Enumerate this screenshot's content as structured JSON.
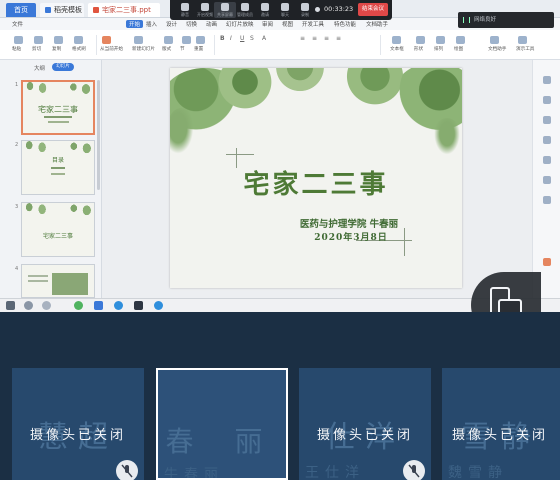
{
  "tabs": {
    "home": "首页",
    "t1": "稻壳模板",
    "t2": "宅家二三事.ppt"
  },
  "meeting": {
    "timer": "00:33:23",
    "end": "结束会议",
    "controls": [
      "静音",
      "开启视频",
      "共享屏幕",
      "管理成员",
      "邀请",
      "聊天",
      "录制"
    ]
  },
  "mini": {
    "text": "网络良好"
  },
  "menu": {
    "items": [
      "文件",
      "开始",
      "插入",
      "设计",
      "切换",
      "动画",
      "幻灯片放映",
      "审阅",
      "视图",
      "开发工具",
      "特色功能",
      "文档助手"
    ],
    "selected": 1
  },
  "ribbon": {
    "buttons": [
      "粘贴",
      "剪切",
      "复制",
      "格式刷",
      "从当前开始",
      "新建幻灯片",
      "版式",
      "节",
      "重置",
      "文本框",
      "形状",
      "排列",
      "绘图",
      "文档助手",
      "演示工具"
    ]
  },
  "pane": {
    "label": "大纲",
    "pill": "幻灯片"
  },
  "thumbnails": [
    {
      "num": "1",
      "title": "宅家二三事"
    },
    {
      "num": "2",
      "title": "目录"
    },
    {
      "num": "3",
      "title": "宅家二三事"
    },
    {
      "num": "4",
      "title": ""
    }
  ],
  "slide": {
    "title": "宅家二三事",
    "subtitle": "医药与护理学院  牛春丽",
    "date": "2020年3月8日"
  },
  "gallery": [
    {
      "bg": "慧超",
      "bg2": "",
      "status": "摄像头已关闭",
      "highlighted": false
    },
    {
      "bg": "春 丽",
      "bg2": "牛春丽",
      "status": "",
      "highlighted": true
    },
    {
      "bg": "仕洋",
      "bg2": "王仕洋",
      "status": "摄像头已关闭",
      "highlighted": false
    },
    {
      "bg": "雪静",
      "bg2": "魏雪静",
      "status": "摄像头已关闭",
      "highlighted": false
    }
  ],
  "colors": {
    "accent": "#3a78d8",
    "end_button": "#e04848",
    "slide_title": "#4e7a36",
    "tile_bg": "#27496d"
  }
}
